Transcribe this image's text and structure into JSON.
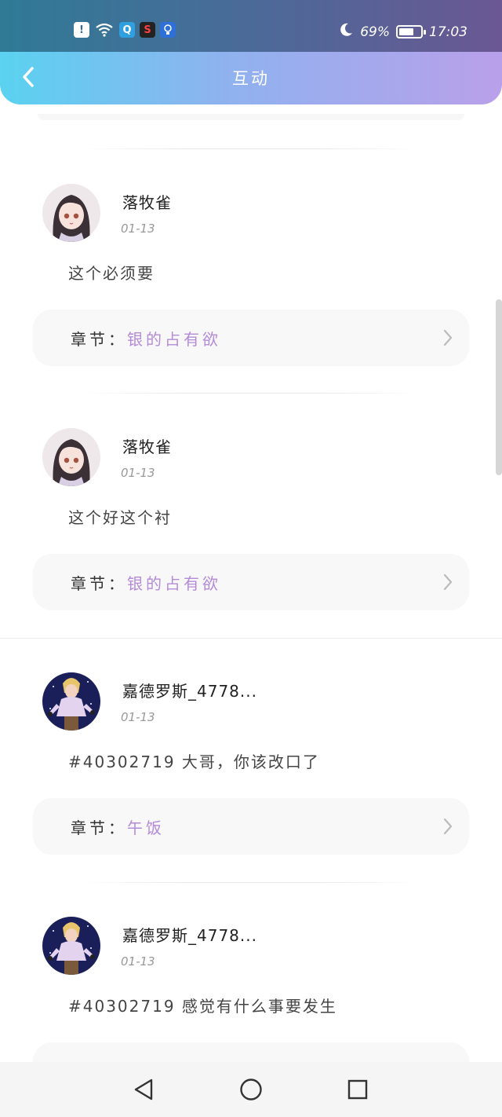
{
  "status_bar": {
    "battery_percent": "69%",
    "battery_level": 0.69,
    "time": "17:03",
    "icons": [
      "alert-icon",
      "wifi-icon",
      "search-app-icon",
      "s-app-icon",
      "bulb-app-icon",
      "moon-icon",
      "battery-icon"
    ]
  },
  "header": {
    "title": "互动",
    "back_icon": "chevron-left-icon"
  },
  "comments": [
    {
      "username": "落牧雀",
      "date": "01-13",
      "text": "这个必须要",
      "chapter_prefix": "章节：",
      "chapter_name": "银的占有欲",
      "avatar": "anime-girl-avatar"
    },
    {
      "username": "落牧雀",
      "date": "01-13",
      "text": "这个好这个衬",
      "chapter_prefix": "章节：",
      "chapter_name": "银的占有欲",
      "avatar": "anime-girl-avatar"
    },
    {
      "username": "嘉德罗斯_4778...",
      "date": "01-13",
      "text": "#40302719 大哥，你该改口了",
      "chapter_prefix": "章节：",
      "chapter_name": "午饭",
      "avatar": "anime-boy-avatar"
    },
    {
      "username": "嘉德罗斯_4778...",
      "date": "01-13",
      "text": "#40302719 感觉有什么事要发生",
      "chapter_prefix": "",
      "chapter_name": "",
      "avatar": "anime-boy-avatar"
    }
  ],
  "colors": {
    "header_gradient_start": "#5ad2f0",
    "header_gradient_end": "#b9a0ea",
    "chapter_accent": "#b38bd8"
  },
  "nav": {
    "icons": [
      "back-triangle-icon",
      "home-circle-icon",
      "recents-square-icon"
    ]
  }
}
